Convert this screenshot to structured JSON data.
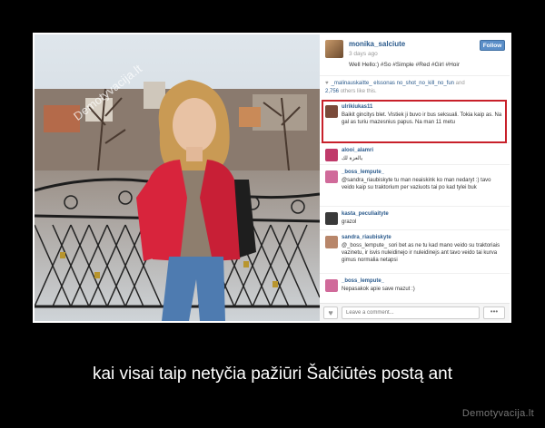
{
  "post": {
    "watermark": "Demotyvacija.lt",
    "username": "monika_salciute",
    "time_ago": "3 days ago",
    "caption": "Well Hello:) #So #Simple #Red #Girl #Hoir",
    "follow_label": "Follow",
    "likes": {
      "names": "_malinauskaitte_ elssonas no_shot_no_kill_no_fun",
      "and_text": "and",
      "others_count": "2,756",
      "others_text": "others like this."
    },
    "comments": [
      {
        "user": "ulrikiukas11",
        "text": "Baikit gincitys blet. Vistiek ji buvo ir bus seksuali. Tokia kaip as. Na gal as turiu mazesnius papus. Na man 11 metu",
        "avatar_color": "#7a4a3a"
      },
      {
        "user": "alooi_alamri",
        "text": "يالعزة لك",
        "avatar_color": "#c03a6a"
      },
      {
        "user": "_boss_lempute_",
        "text": "@sandra_riaubiskyte tu man neaiskink ko man nedaryt :) tavo veido kaip su traktorium per vaziuots tai po kad tylei buk",
        "avatar_color": "#d06a9a"
      },
      {
        "user": "kasta_peculiaityte",
        "text": "grazol",
        "avatar_color": "#3a3a3a"
      },
      {
        "user": "sandra_riaubiskyte",
        "text": "@_boss_lempute_ sori bet as ne tu kad mano veido su traktoriais vazinetu, ir isvis nuleidinejo ir nuleidinejs ant tavo veido tai kurva gimus normalia netapsi",
        "avatar_color": "#b8866a"
      },
      {
        "user": "_boss_lempute_",
        "text": "Nepasakok apie save mazut :)",
        "avatar_color": "#d06a9a"
      }
    ],
    "comment_placeholder": "Leave a comment...",
    "more_label": "•••"
  },
  "motto": "kai visai taip netyčia pažiūri Šalčiūtės postą ant",
  "site": "Demotyvacija.lt",
  "colors": {
    "highlight": "#c8202a",
    "jacket": "#d8243c",
    "link": "#2a5a8c"
  }
}
